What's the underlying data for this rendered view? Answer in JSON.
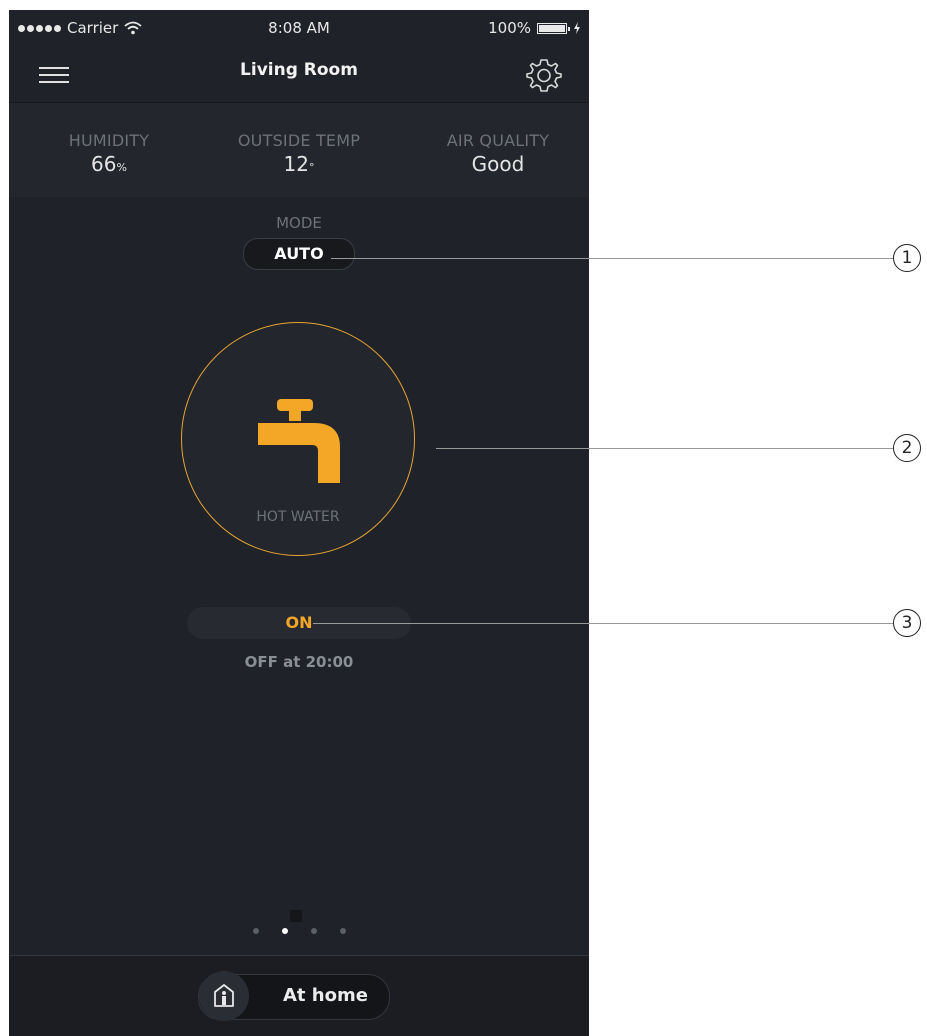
{
  "status_bar": {
    "carrier": "Carrier",
    "time": "8:08 AM",
    "battery": "100%"
  },
  "nav": {
    "title": "Living Room"
  },
  "stats": [
    {
      "label": "HUMIDITY",
      "value": "66",
      "unit": "%"
    },
    {
      "label": "OUTSIDE TEMP",
      "value": "12",
      "unit": "°"
    },
    {
      "label": "AIR QUALITY",
      "value": "Good",
      "unit": ""
    }
  ],
  "mode": {
    "label": "MODE",
    "value": "AUTO"
  },
  "device": {
    "name": "HOT WATER",
    "icon": "tap-icon",
    "accent_color": "#f4a727"
  },
  "state": {
    "value": "ON",
    "schedule": "OFF at 20:00"
  },
  "pager": {
    "count": 4,
    "active_index": 1
  },
  "bottom": {
    "presence": "At home"
  },
  "callouts": [
    "1",
    "2",
    "3"
  ]
}
